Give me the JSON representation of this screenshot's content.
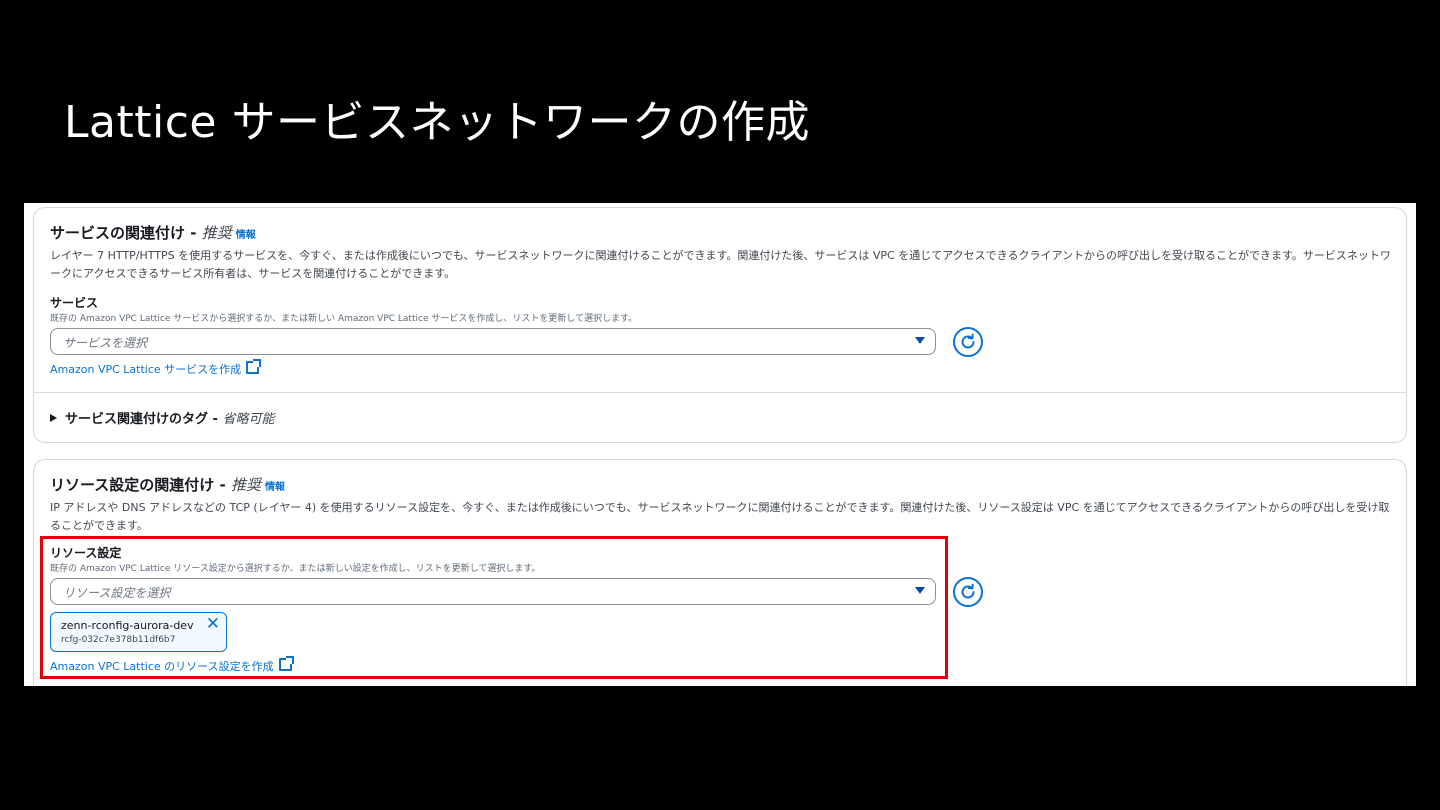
{
  "slide_title": "Lattice サービスネットワークの作成",
  "service_assoc": {
    "title": "サービスの関連付け",
    "sep": " - ",
    "optional": "推奨",
    "info": "情報",
    "desc": "レイヤー 7 HTTP/HTTPS を使用するサービスを、今すぐ、または作成後にいつでも、サービスネットワークに関連付けることができます。関連付けた後、サービスは VPC を通じてアクセスできるクライアントからの呼び出しを受け取ることができます。サービスネットワークにアクセスできるサービス所有者は、サービスを関連付けることができます。",
    "field_label": "サービス",
    "field_hint": "既存の Amazon VPC Lattice サービスから選択するか、または新しい Amazon VPC Lattice サービスを作成し、リストを更新して選択します。",
    "select_placeholder": "サービスを選択",
    "create_link": "Amazon VPC Lattice サービスを作成",
    "tags_title": "サービス関連付けのタグ",
    "tags_sep": " - ",
    "tags_optional": "省略可能"
  },
  "resource_assoc": {
    "title": "リソース設定の関連付け",
    "sep": " - ",
    "optional": "推奨",
    "info": "情報",
    "desc": "IP アドレスや DNS アドレスなどの TCP (レイヤー 4) を使用するリソース設定を、今すぐ、または作成後にいつでも、サービスネットワークに関連付けることができます。関連付けた後、リソース設定は VPC を通じてアクセスできるクライアントからの呼び出しを受け取ることができます。",
    "field_label": "リソース設定",
    "field_hint": "既存の Amazon VPC Lattice リソース設定から選択するか、または新しい設定を作成し、リストを更新して選択します。",
    "select_placeholder": "リソース設定を選択",
    "token": {
      "name": "zenn-rconfig-aurora-dev",
      "id": "rcfg-032c7e378b11df6b7",
      "remove_icon": "close-icon"
    },
    "create_link": "Amazon VPC Lattice のリソース設定を作成"
  },
  "colors": {
    "link": "#0972d3",
    "highlight": "#e3000b",
    "background": "#000000"
  }
}
